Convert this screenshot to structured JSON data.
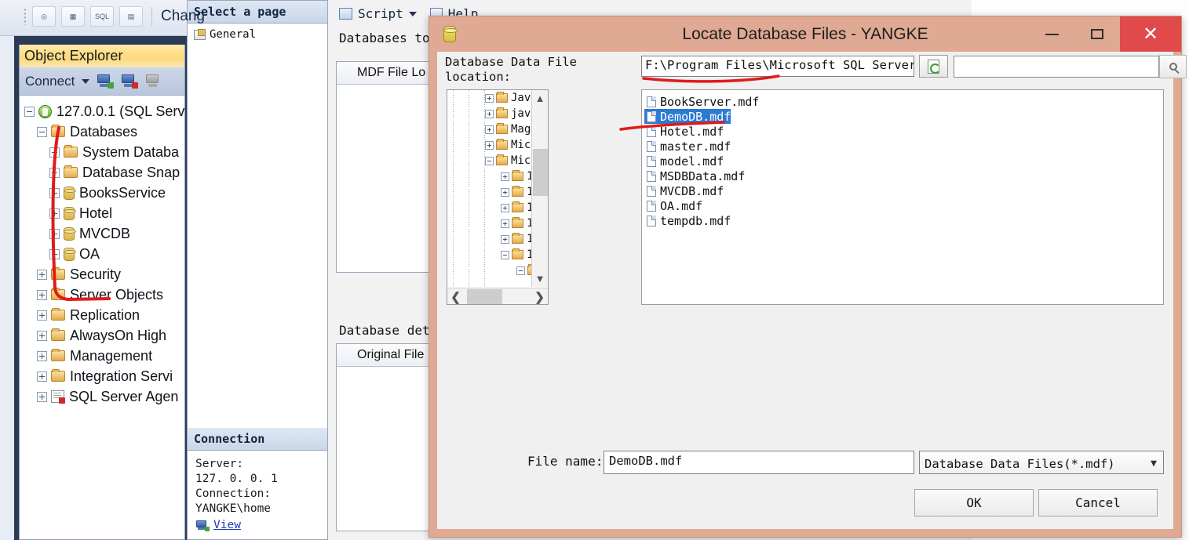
{
  "ssms": {
    "toolbar": {
      "buttons": [
        "new-query-icon",
        "table-icon",
        "sql-icon",
        "analysis-icon"
      ],
      "change_label": "Chang"
    },
    "object_explorer": {
      "title": "Object Explorer",
      "connect_label": "Connect",
      "toolbar_icons": [
        "connect-icon",
        "disconnect-icon",
        "stop-icon"
      ],
      "tree": [
        {
          "label": "127.0.0.1 (SQL Serv",
          "icon": "server-icon",
          "indent": 0,
          "state": "expanded"
        },
        {
          "label": "Databases",
          "icon": "folder-icon",
          "indent": 1,
          "state": "expanded"
        },
        {
          "label": "System Databa",
          "icon": "folder-icon",
          "indent": 2,
          "state": "collapsed"
        },
        {
          "label": "Database Snap",
          "icon": "folder-icon",
          "indent": 2,
          "state": "collapsed"
        },
        {
          "label": "BooksService",
          "icon": "database-icon",
          "indent": 2,
          "state": "collapsed"
        },
        {
          "label": "Hotel",
          "icon": "database-icon",
          "indent": 2,
          "state": "collapsed"
        },
        {
          "label": "MVCDB",
          "icon": "database-icon",
          "indent": 2,
          "state": "collapsed"
        },
        {
          "label": "OA",
          "icon": "database-icon",
          "indent": 2,
          "state": "collapsed"
        },
        {
          "label": "Security",
          "icon": "folder-icon",
          "indent": 1,
          "state": "collapsed"
        },
        {
          "label": "Server Objects",
          "icon": "folder-icon",
          "indent": 1,
          "state": "collapsed"
        },
        {
          "label": "Replication",
          "icon": "folder-icon",
          "indent": 1,
          "state": "collapsed"
        },
        {
          "label": "AlwaysOn High ",
          "icon": "folder-icon",
          "indent": 1,
          "state": "collapsed"
        },
        {
          "label": "Management",
          "icon": "folder-icon",
          "indent": 1,
          "state": "collapsed"
        },
        {
          "label": "Integration Servi",
          "icon": "folder-icon",
          "indent": 1,
          "state": "collapsed"
        },
        {
          "label": "SQL Server Agen",
          "icon": "agent-icon",
          "indent": 1,
          "state": "collapsed"
        }
      ]
    }
  },
  "properties_window": {
    "select_page_header": "Select a page",
    "page_items": [
      "General"
    ],
    "connection_header": "Connection",
    "connection_lines": [
      "Server:",
      "127. 0. 0. 1",
      "Connection:",
      "YANGKE\\home"
    ],
    "view_link": "View",
    "script_label": "Script",
    "help_label": "Help",
    "databases_to_label": "Databases to",
    "mdf_column_header": "MDF File Lo",
    "database_details_label": "Database deta",
    "original_file_header": "Original File Na"
  },
  "dialog": {
    "title": "Locate Database Files - YANGKE",
    "title_icon": "database-icon",
    "window_buttons": {
      "minimize": "minimize-icon",
      "maximize": "maximize-icon",
      "close": "close-icon"
    },
    "location_label": "Database Data File location:",
    "path_value": "F:\\Program Files\\Microsoft SQL Server",
    "refresh_icon": "refresh-icon",
    "search_value": "",
    "search_placeholder": "",
    "search_icon": "search-icon",
    "tree_nodes": [
      {
        "label": "Jav",
        "indent": 1,
        "state": "collapsed"
      },
      {
        "label": "jav",
        "indent": 1,
        "state": "collapsed"
      },
      {
        "label": "Mag",
        "indent": 1,
        "state": "collapsed"
      },
      {
        "label": "Mic",
        "indent": 1,
        "state": "collapsed"
      },
      {
        "label": "Mic",
        "indent": 1,
        "state": "expanded"
      },
      {
        "label": "1",
        "indent": 2,
        "state": "collapsed"
      },
      {
        "label": "1",
        "indent": 2,
        "state": "collapsed"
      },
      {
        "label": "1",
        "indent": 2,
        "state": "collapsed"
      },
      {
        "label": "1",
        "indent": 2,
        "state": "collapsed"
      },
      {
        "label": "1",
        "indent": 2,
        "state": "collapsed"
      },
      {
        "label": "1",
        "indent": 2,
        "state": "expanded"
      },
      {
        "label": "",
        "indent": 3,
        "state": "expanded"
      }
    ],
    "files": [
      {
        "name": "BookServer.mdf",
        "selected": false
      },
      {
        "name": "DemoDB.mdf",
        "selected": true
      },
      {
        "name": "Hotel.mdf",
        "selected": false
      },
      {
        "name": "master.mdf",
        "selected": false
      },
      {
        "name": "model.mdf",
        "selected": false
      },
      {
        "name": "MSDBData.mdf",
        "selected": false
      },
      {
        "name": "MVCDB.mdf",
        "selected": false
      },
      {
        "name": "OA.mdf",
        "selected": false
      },
      {
        "name": "tempdb.mdf",
        "selected": false
      }
    ],
    "file_name_label": "File name:",
    "file_name_value": "DemoDB.mdf",
    "file_type_value": "Database Data Files(*.mdf)",
    "ok_label": "OK",
    "cancel_label": "Cancel"
  },
  "colors": {
    "dialog_titlebar": "#dfa993",
    "close_button": "#e04a4a",
    "selection_blue": "#2b7bd4",
    "annotation_red": "#e01b1b",
    "oe_title_gold": "#fdd979"
  }
}
